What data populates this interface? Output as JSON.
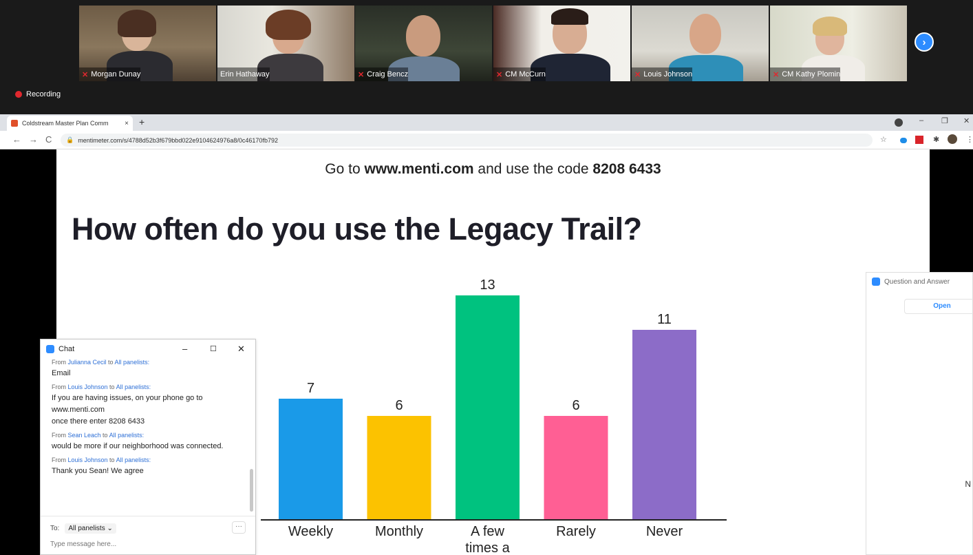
{
  "zoom": {
    "participants": [
      {
        "name": "Morgan Dunay"
      },
      {
        "name": "Erin Hathaway"
      },
      {
        "name": "Craig Bencz"
      },
      {
        "name": "CM McCurn"
      },
      {
        "name": "Louis Johnson"
      },
      {
        "name": "CM Kathy Plomin"
      }
    ],
    "recording_label": "Recording",
    "next_icon": "chevron-right-icon"
  },
  "browser": {
    "tab_title": "Coldstream Master Plan Comm",
    "tab_close": "×",
    "new_tab": "+",
    "url": "mentimeter.com/s/4788d52b3f679bbd022e9104624976a8/0c46170fb792",
    "window_controls": [
      "–",
      "❐",
      "✕"
    ],
    "nav": [
      "←",
      "→",
      "C"
    ]
  },
  "slide": {
    "join_prefix": "Go to ",
    "join_site": "www.menti.com",
    "join_mid": " and use the code ",
    "join_code": "8208 6433",
    "question": "How often do you use the Legacy Trail?"
  },
  "chart_data": {
    "type": "bar",
    "title": "How often do you use the Legacy Trail?",
    "categories": [
      "Weekly",
      "Monthly",
      "A few times a",
      "Rarely",
      "Never"
    ],
    "values": [
      7,
      6,
      13,
      6,
      11
    ],
    "colors": [
      "#1a9ae8",
      "#fcc200",
      "#00c27f",
      "#ff5f94",
      "#8c6cc8"
    ],
    "ylim": [
      0,
      13
    ],
    "grid": false
  },
  "qa": {
    "title": "Question and Answer",
    "tab": "Open",
    "cut_text": "N"
  },
  "chat": {
    "title": "Chat",
    "messages": [
      {
        "from": "Julianna Cecil",
        "to": "All panelists:",
        "text": "Email"
      },
      {
        "from": "Louis Johnson",
        "to": "All panelists:",
        "text": "If you are having issues, on your phone go to www.menti.com\nonce there enter 8208 6433"
      },
      {
        "from": "Sean Leach",
        "to": "All panelists:",
        "text": "would be more if our neighborhood was connected."
      },
      {
        "from": "Louis Johnson",
        "to": "All panelists:",
        "text": "Thank you Sean! We agree"
      }
    ],
    "from_word": "From ",
    "to_word": " to ",
    "to_label": "To:",
    "to_value": "All panelists ⌄",
    "more": "···",
    "placeholder": "Type message here..."
  }
}
